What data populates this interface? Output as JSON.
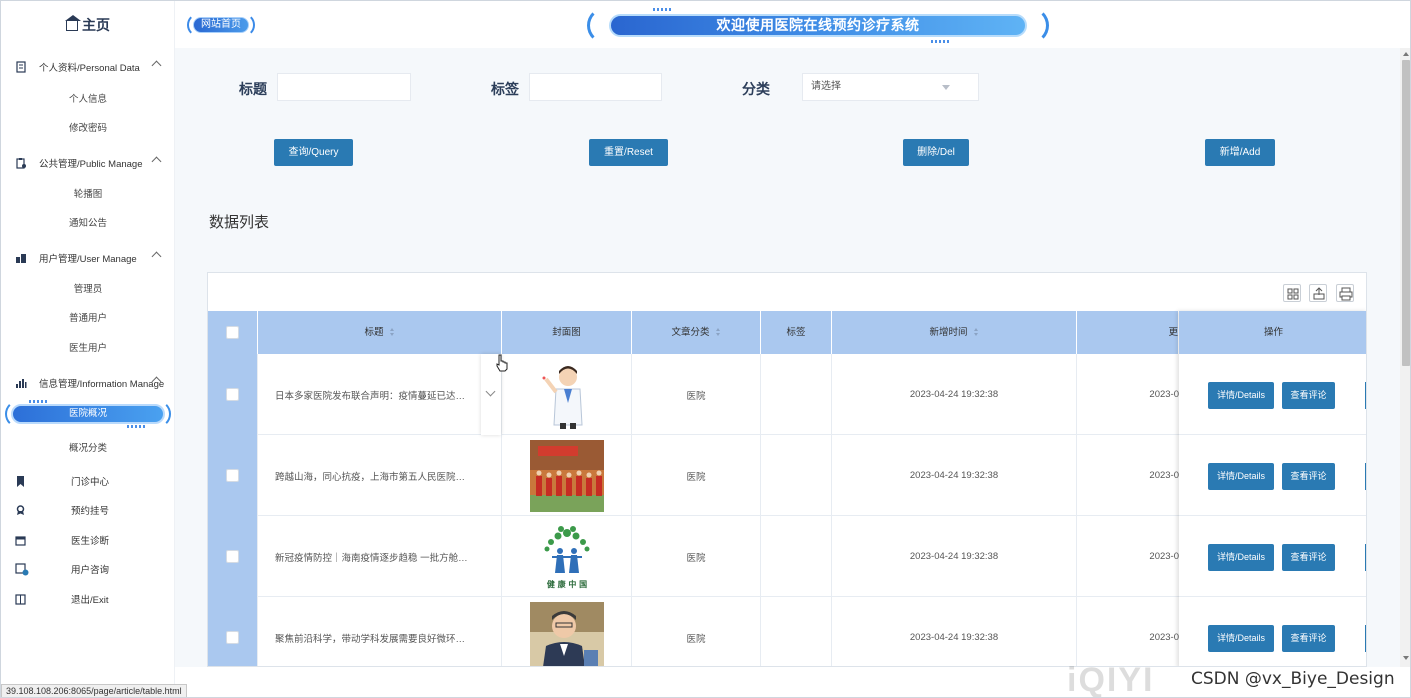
{
  "sidebar": {
    "home": "主页",
    "groups": [
      {
        "label": "个人资料/Personal Data",
        "items": [
          "个人信息",
          "修改密码"
        ]
      },
      {
        "label": "公共管理/Public Manage",
        "items": [
          "轮播图",
          "通知公告"
        ]
      },
      {
        "label": "用户管理/User Manage",
        "items": [
          "管理员",
          "普通用户",
          "医生用户"
        ]
      },
      {
        "label": "信息管理/Information Manage",
        "items": [
          "医院概况",
          "概况分类"
        ]
      }
    ],
    "active_item": "医院概况",
    "menu": [
      "门诊中心",
      "预约挂号",
      "医生诊断",
      "用户咨询",
      "退出/Exit"
    ]
  },
  "header": {
    "site_home": "网站首页",
    "title": "欢迎使用医院在线预约诊疗系统"
  },
  "filters": {
    "title_label": "标题",
    "tag_label": "标签",
    "category_label": "分类",
    "category_placeholder": "请选择"
  },
  "buttons": {
    "query": "查询/Query",
    "reset": "重置/Reset",
    "delete": "删除/Del",
    "add": "新增/Add"
  },
  "section_title": "数据列表",
  "table": {
    "columns": [
      "标题",
      "封面图",
      "文章分类",
      "标签",
      "新增时间",
      "更",
      "操作"
    ],
    "rows": [
      {
        "title": "日本多家医院发布联合声明：疫情蔓延已达…",
        "category": "医院",
        "tag": "",
        "time": "2023-04-24 19:32:38",
        "updated": "2023-0"
      },
      {
        "title": "跨越山海，同心抗疫，上海市第五人民医院…",
        "category": "医院",
        "tag": "",
        "time": "2023-04-24 19:32:38",
        "updated": "2023-0"
      },
      {
        "title": "新冠疫情防控｜海南疫情逐步趋稳 一批方舱…",
        "category": "医院",
        "tag": "",
        "time": "2023-04-24 19:32:38",
        "updated": "2023-0"
      },
      {
        "title": "聚焦前沿科学，带动学科发展需要良好微环…",
        "category": "医院",
        "tag": "",
        "time": "2023-04-24 19:32:38",
        "updated": "2023-0"
      }
    ],
    "op_details": "详情/Details",
    "op_comments": "查看评论",
    "cover3_caption": "健 康 中 国"
  },
  "status_url": "39.108.108.206:8065/page/article/table.html",
  "watermark": "CSDN @vx_Biye_Design",
  "watermark_logo": "iQIYI",
  "colors": {
    "primary_button": "#2a7ab3",
    "table_header": "#aac8ef",
    "banner": "#3f8de6"
  }
}
